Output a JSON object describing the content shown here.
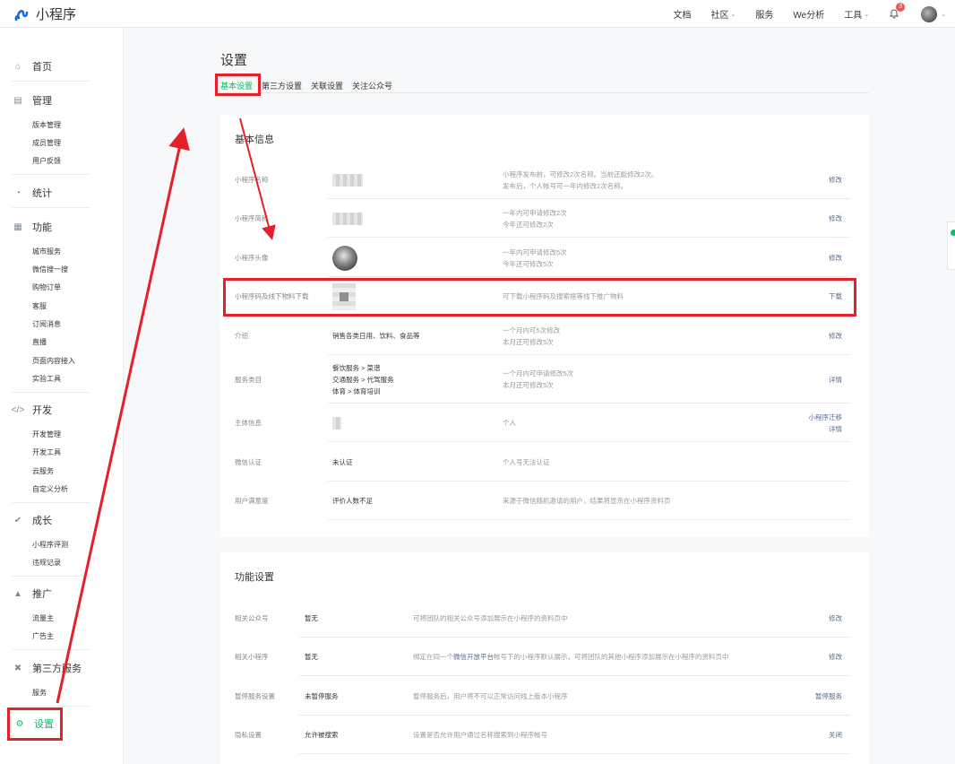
{
  "brand": {
    "name": "小程序",
    "accent": "#07c160",
    "link_color": "#576b95",
    "annotation_color": "#e5202b"
  },
  "topnav": {
    "docs": "文档",
    "community": "社区",
    "service": "服务",
    "analytics": "We分析",
    "tools": "工具",
    "notification_count": "3"
  },
  "sidebar": {
    "home": "首页",
    "manage": {
      "label": "管理",
      "items": [
        "版本管理",
        "成员管理",
        "用户反馈"
      ]
    },
    "stats": "统计",
    "features": {
      "label": "功能",
      "items": [
        "城市服务",
        "微信搜一搜",
        "购物订单",
        "客服",
        "订阅消息",
        "直播",
        "页面内容接入",
        "实验工具"
      ]
    },
    "dev": {
      "label": "开发",
      "items": [
        "开发管理",
        "开发工具",
        "云服务",
        "自定义分析"
      ]
    },
    "growth": {
      "label": "成长",
      "items": [
        "小程序评测",
        "违规记录"
      ]
    },
    "promo": {
      "label": "推广",
      "items": [
        "流量主",
        "广告主"
      ]
    },
    "third_party": {
      "label": "第三方服务",
      "items": [
        "服务"
      ]
    },
    "settings": "设置"
  },
  "page": {
    "title": "设置",
    "tabs": [
      "基本设置",
      "第三方设置",
      "关联设置",
      "关注公众号"
    ]
  },
  "basic_info": {
    "title": "基本信息",
    "rows": [
      {
        "label": "小程序名称",
        "desc1": "小程序发布前，可修改2次名称。当前还能修改2次。",
        "desc2": "发布后，个人帐号可一年内修改2次名称。",
        "action": "修改"
      },
      {
        "label": "小程序简称",
        "desc1": "一年内可申请修改2次",
        "desc2": "今年还可修改2次",
        "action": "修改"
      },
      {
        "label": "小程序头像",
        "desc1": "一年内可申请修改5次",
        "desc2": "今年还可修改5次",
        "action": "修改"
      },
      {
        "label": "小程序码及线下物料下载",
        "desc1": "可下载小程序码及搜索框等线下推广物料",
        "action": "下载"
      },
      {
        "label": "介绍",
        "value": "销售各类日用、饮料、食品等",
        "desc1": "一个月内可5次修改",
        "desc2": "本月还可修改5次",
        "action": "修改"
      },
      {
        "label": "服务类目",
        "value_lines": [
          "餐饮服务 > 菜谱",
          "交通服务 > 代驾服务",
          "体育 > 体育培训"
        ],
        "desc1": "一个月内可申请修改5次",
        "desc2": "本月还可修改5次",
        "action": "详情"
      },
      {
        "label": "主体信息",
        "desc1": "个人",
        "action": "小程序迁移",
        "action2": "详情"
      },
      {
        "label": "微信认证",
        "value": "未认证",
        "desc1": "个人号无法认证"
      },
      {
        "label": "用户满意度",
        "value": "评价人数不足",
        "desc1": "来源于微信随机邀请的用户，结果将显示在小程序资料页"
      }
    ]
  },
  "feature_settings": {
    "title": "功能设置",
    "rows": [
      {
        "label": "相关公众号",
        "value": "暂无",
        "desc": "可将团队的相关公众号添加展示在小程序的资料页中",
        "action": "修改"
      },
      {
        "label": "相关小程序",
        "value": "暂无",
        "desc_pre": "绑定在同一个",
        "desc_link": "微信开放平台",
        "desc_post": "帐号下的小程序默认展示，可将团队的其他小程序添加展示在小程序的资料页中",
        "action": "修改"
      },
      {
        "label": "暂停服务设置",
        "value": "未暂停服务",
        "desc": "暂停服务后，用户将不可以正常访问线上版本小程序",
        "action": "暂停服务"
      },
      {
        "label": "隐私设置",
        "value": "允许被搜索",
        "desc": "设置是否允许用户通过名称搜索到小程序帐号",
        "action": "关闭"
      }
    ]
  }
}
